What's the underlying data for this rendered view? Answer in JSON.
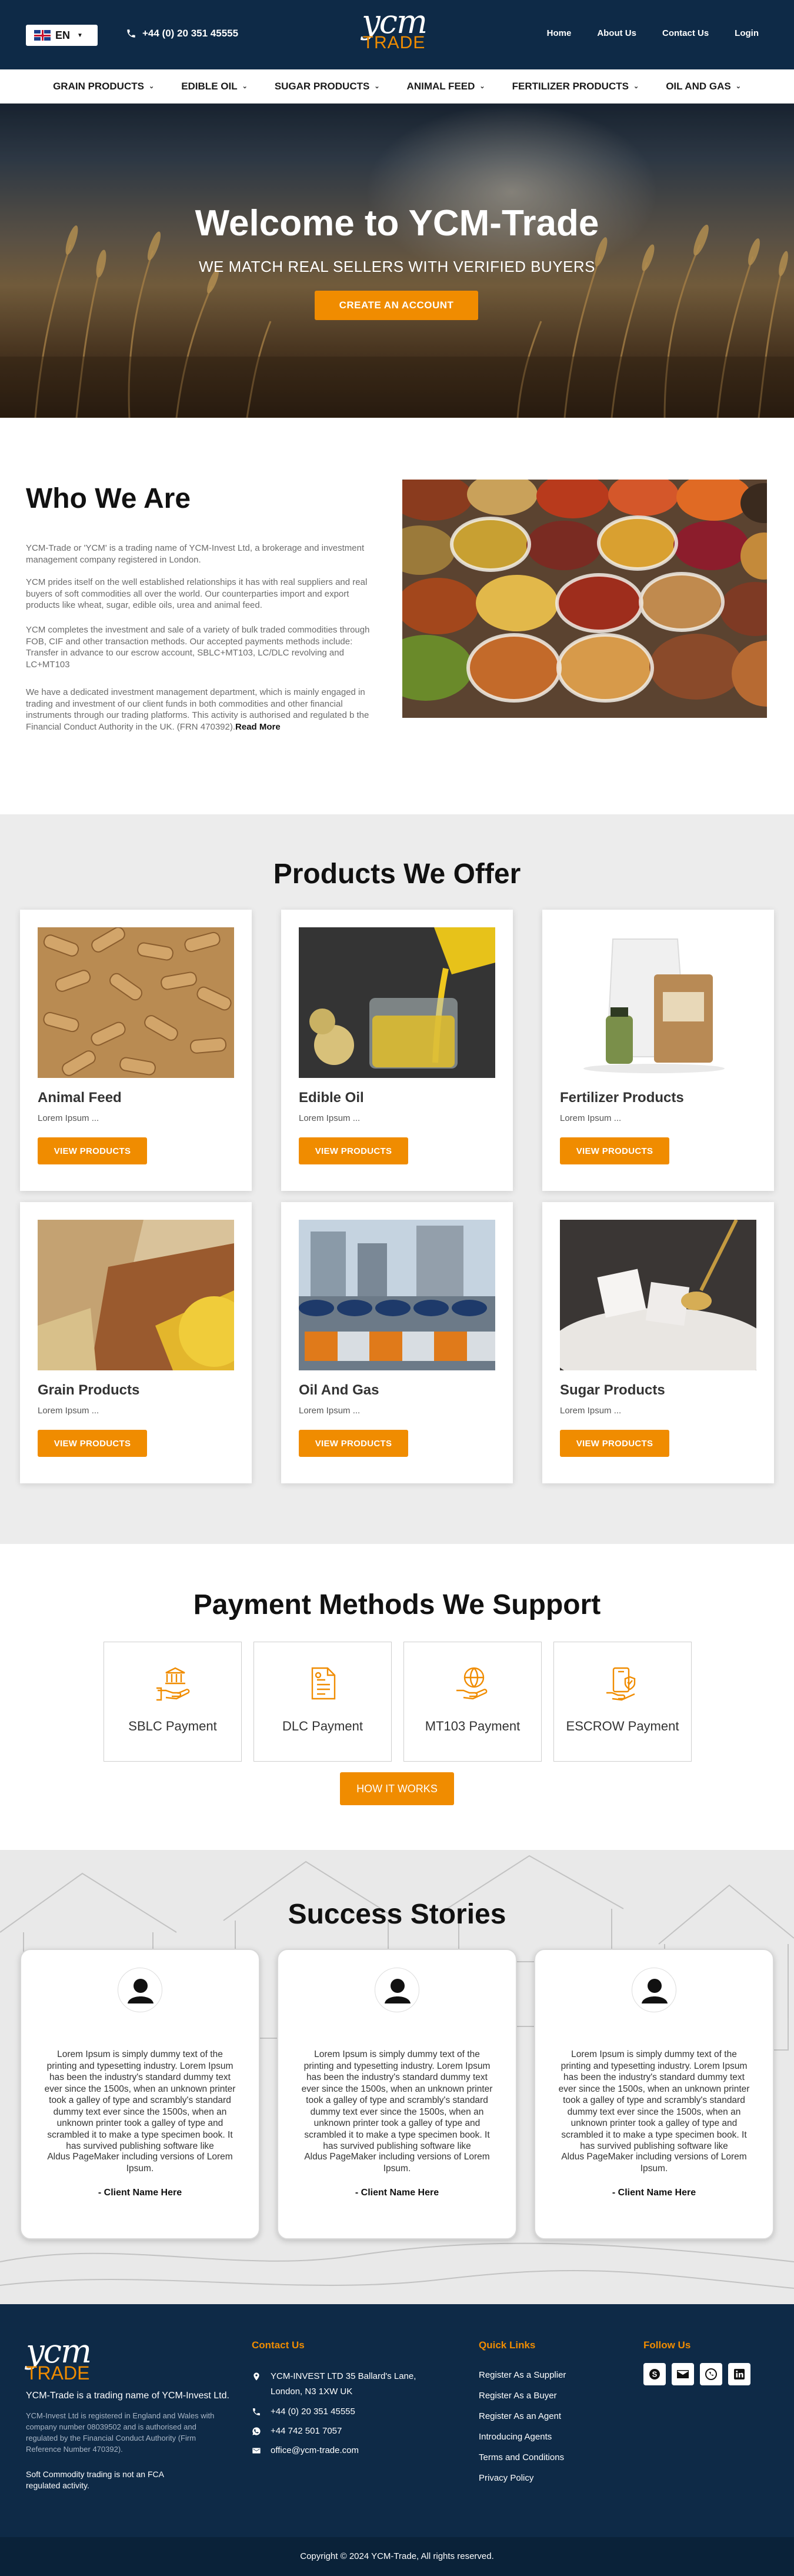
{
  "topbar": {
    "lang_label": "EN",
    "phone": "+44 (0) 20 351 45555",
    "logo_text_top": "ycm",
    "logo_text_bottom": "TRADE",
    "nav": [
      "Home",
      "About Us",
      "Contact Us",
      "Login"
    ]
  },
  "category_nav": [
    "GRAIN PRODUCTS",
    "EDIBLE OIL",
    "SUGAR PRODUCTS",
    "ANIMAL FEED",
    "FERTILIZER PRODUCTS",
    "OIL AND GAS"
  ],
  "hero": {
    "title": "Welcome to YCM-Trade",
    "subtitle": "WE MATCH REAL SELLERS WITH VERIFIED BUYERS",
    "cta": "CREATE AN ACCOUNT"
  },
  "who": {
    "title": "Who We Are",
    "p1": "YCM-Trade or 'YCM' is a trading name of YCM-Invest Ltd, a brokerage and investment management company registered in London.",
    "p2": "YCM prides itself on the well established relationships it has with real suppliers and real buyers of soft commodities all over the world. Our counterparties import and export products like wheat, sugar, edible oils, urea and animal feed.",
    "p3": "YCM completes the investment and sale of a variety of bulk traded commodities through FOB, CIF and other transaction methods. Our accepted payments methods include: Transfer in advance to our escrow account, SBLC+MT103, LC/DLC revolving and LC+MT103",
    "p4": "We have a dedicated investment management department, which is mainly engaged in trading and investment of our client funds in both commodities and other financial instruments through our trading platforms. This activity is authorised and regulated b the Financial Conduct Authority in the UK. (FRN 470392).",
    "read_more": "Read More"
  },
  "products": {
    "title": "Products We Offer",
    "button_label": "VIEW PRODUCTS",
    "items": [
      {
        "name": "Animal Feed",
        "desc": "Lorem Ipsum ..."
      },
      {
        "name": "Edible Oil",
        "desc": "Lorem Ipsum ..."
      },
      {
        "name": "Fertilizer Products",
        "desc": "Lorem Ipsum ..."
      },
      {
        "name": "Grain Products",
        "desc": "Lorem Ipsum ..."
      },
      {
        "name": "Oil And Gas",
        "desc": "Lorem Ipsum ..."
      },
      {
        "name": "Sugar Products",
        "desc": "Lorem Ipsum ..."
      }
    ]
  },
  "payment": {
    "title": "Payment Methods We Support",
    "methods": [
      {
        "label": "SBLC Payment",
        "icon": "bank-hand-icon"
      },
      {
        "label": "DLC Payment",
        "icon": "document-icon"
      },
      {
        "label": "MT103 Payment",
        "icon": "globe-hand-icon"
      },
      {
        "label": "ESCROW Payment",
        "icon": "secure-payment-icon"
      }
    ],
    "how_label": "HOW IT WORKS"
  },
  "success": {
    "title": "Success Stories",
    "quote": "Lorem Ipsum is simply dummy text of the printing and typesetting industry. Lorem Ipsum has been the industry's standard dummy text ever since the 1500s, when an unknown printer took a galley of type and scrambled it to make a type specimen book. It has survived publishing software like",
    "quote_2": "Lorem Ipsum is simply dummy text of the printing and typesetting industry. Lorem Ipsum has been the industry's standard dummy text ever since the 1500s, when an unknown printer took a galley of type and scrambly's standard dummy text ever since the 1500s, when an unknown printer took a galley of type and scrambled it to make a type specimen book. It has survived publishing software like",
    "quote_tail": "Aldus PageMaker including versions of Lorem Ipsum.",
    "client": "- Client Name Here"
  },
  "footer": {
    "logo_top": "ycm",
    "logo_bottom": "TRADE",
    "tagline": "YCM-Trade is a trading name of YCM-Invest Ltd.",
    "reg": "YCM-Invest Ltd is registered in England and Wales with company number 08039502 and is authorised and regulated by the Financial Conduct Authority (Firm Reference Number 470392).",
    "note": "Soft Commodity trading is not an FCA regulated activity.",
    "contact_title": "Contact Us",
    "address": "YCM-INVEST LTD 35 Ballard's Lane, London, N3 1XW UK",
    "phone": "+44 (0) 20 351 45555",
    "whatsapp": "+44 742 501 7057",
    "email": "office@ycm-trade.com",
    "quick_title": "Quick Links",
    "quick_links": [
      "Register As a Supplier",
      "Register As a Buyer",
      "Register As an Agent",
      "Introducing Agents",
      "Terms and Conditions",
      "Privacy Policy"
    ],
    "follow_title": "Follow Us",
    "social": [
      "skype-icon",
      "email-icon",
      "whatsapp-icon",
      "linkedin-icon"
    ],
    "copyright": "Copyright © 2024 YCM-Trade, All rights reserved."
  },
  "colors": {
    "navy": "#0e2a47",
    "accent": "#f08c00",
    "products_bg": "#ececec"
  }
}
